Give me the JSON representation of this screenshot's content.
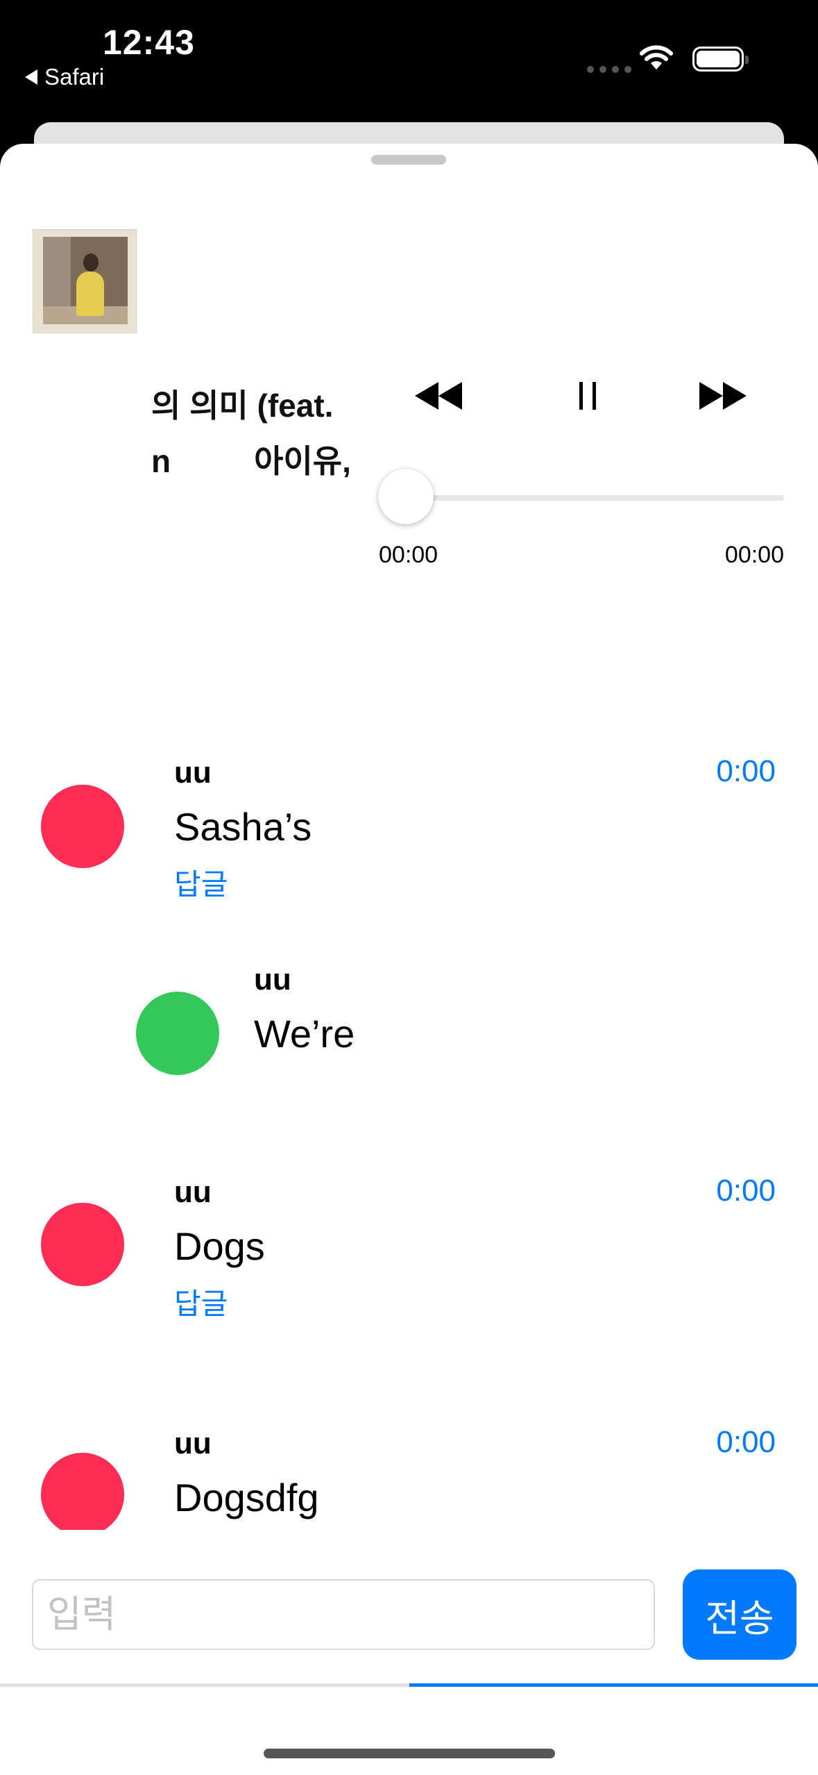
{
  "status_bar": {
    "time": "12:43",
    "back_app": "Safari"
  },
  "player": {
    "song_title": "의 의미 (feat.",
    "song_artist_part1": "n",
    "song_artist_part2": "아이유,",
    "progress_fraction": 0,
    "time_current": "00:00",
    "time_total": "00:00"
  },
  "comments": [
    {
      "user": "uu",
      "text": "Sasha’s",
      "time": "0:00",
      "reply_label": "답글",
      "avatar_color": "#ff2d55",
      "is_reply": false
    },
    {
      "user": "uu",
      "text": "We’re",
      "avatar_color": "#34c759",
      "is_reply": true
    },
    {
      "user": "uu",
      "text": "Dogs",
      "time": "0:00",
      "reply_label": "답글",
      "avatar_color": "#ff2d55",
      "is_reply": false
    },
    {
      "user": "uu",
      "text": "Dogsdfg",
      "time": "0:00",
      "avatar_color": "#ff2d55",
      "is_reply": false
    }
  ],
  "composer": {
    "placeholder": "입력",
    "value": "",
    "send_label": "전송"
  },
  "colors": {
    "accent": "#007aff",
    "avatar_red": "#ff2d55",
    "avatar_green": "#34c759"
  }
}
